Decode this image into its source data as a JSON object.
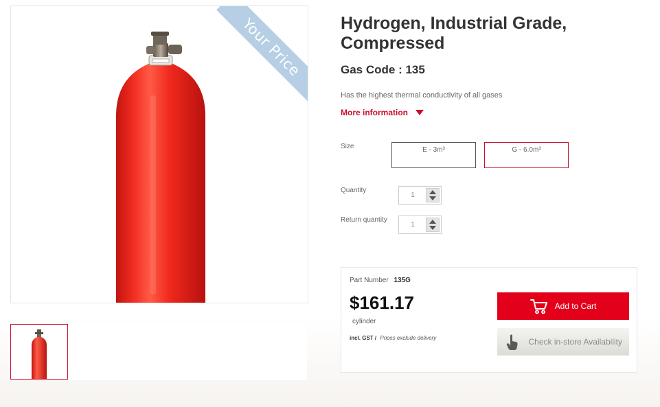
{
  "product": {
    "title": "Hydrogen, Industrial Grade, Compressed",
    "gas_code": "Gas Code : 135",
    "description": "Has the highest thermal conductivity of all gases",
    "more_info": "More information",
    "ribbon": "Your Price"
  },
  "options": {
    "size_label": "Size",
    "sizes": [
      {
        "label": "E - 3m³",
        "selected": false
      },
      {
        "label": "G - 6.0m³",
        "selected": true
      }
    ],
    "quantity_label": "Quantity",
    "quantity_value": "1",
    "return_quantity_label": "Return quantity",
    "return_quantity_value": "1"
  },
  "purchase": {
    "part_number_label": "Part Number",
    "part_number": "135G",
    "price": "$161.17",
    "unit": "cylinder",
    "gst_label": "incl. GST",
    "separator": "/",
    "delivery_note": "Prices exclude delivery",
    "add_to_cart": "Add to Cart",
    "check_store": "Check in-store Availability"
  },
  "colors": {
    "accent": "#c8102e",
    "cart_button": "#e2001a",
    "ribbon": "#b6cfe4",
    "cylinder": "#e8231a"
  }
}
